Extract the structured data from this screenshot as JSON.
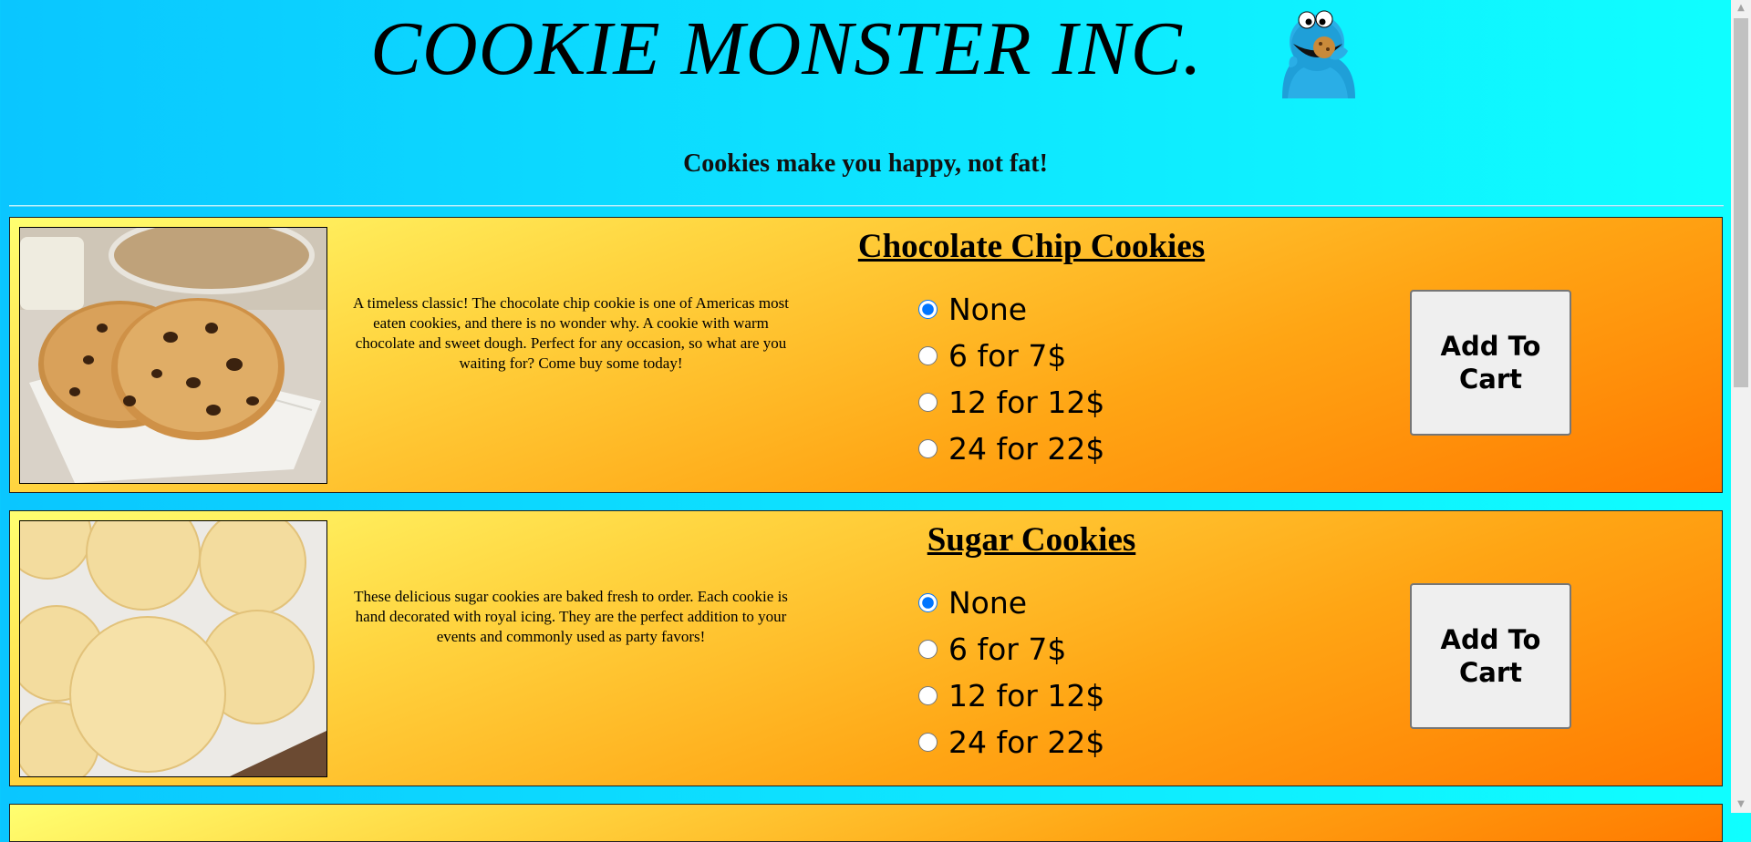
{
  "header": {
    "title": "COOKIE MONSTER INC.",
    "tagline": "Cookies make you happy, not fat!",
    "mascot_icon": "cookie-monster-icon"
  },
  "products": [
    {
      "title": "Chocolate Chip Cookies",
      "description": "A timeless classic! The chocolate chip cookie is one of Americas most eaten cookies, and there is no wonder why. A cookie with warm chocolate and sweet dough. Perfect for any occasion, so what are you waiting for? Come buy some today!",
      "options": [
        "None",
        "6 for 7$",
        "12 for 12$",
        "24 for 22$"
      ],
      "selected": "None",
      "button_label": "Add To Cart"
    },
    {
      "title": "Sugar Cookies",
      "description": "These delicious sugar cookies are baked fresh to order. Each cookie is hand decorated with royal icing. They are the perfect addition to your events and commonly used as party favors!",
      "options": [
        "None",
        "6 for 7$",
        "12 for 12$",
        "24 for 22$"
      ],
      "selected": "None",
      "button_label": "Add To Cart"
    }
  ],
  "colors": {
    "page_bg": "#0ee9ff",
    "card_gradient_start": "#ffff70",
    "card_gradient_end": "#ff7a00"
  }
}
